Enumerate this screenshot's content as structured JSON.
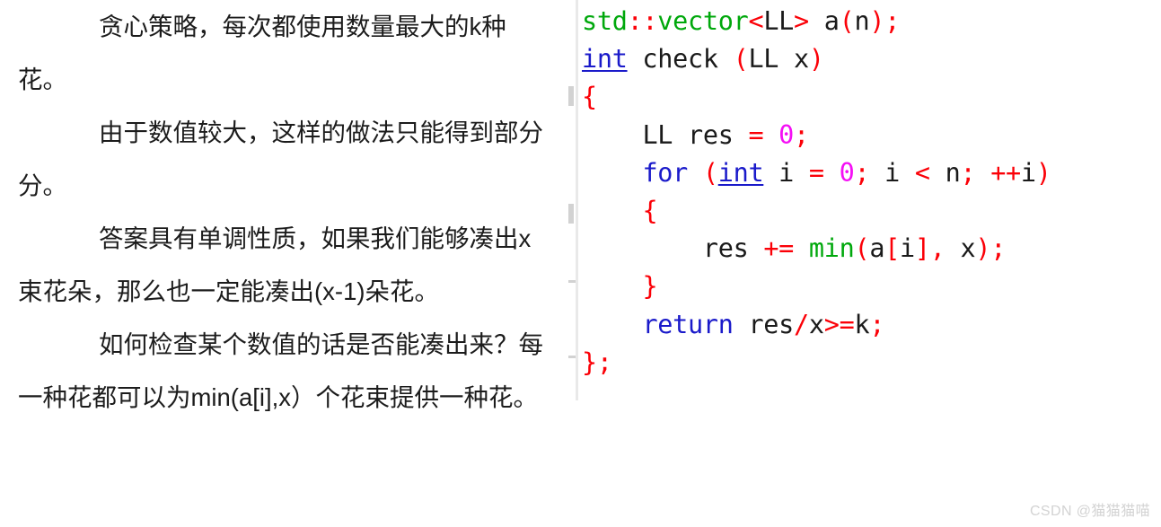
{
  "prose": {
    "paragraphs": [
      "贪心策略，每次都使用数量最大的k种花。",
      "由于数值较大，这样的做法只能得到部分分。",
      "答案具有单调性质，如果我们能够凑出x束花朵，那么也一定能凑出(x-1)朵花。",
      "如何检查某个数值的话是否能凑出来？每一种花都可以为min(a[i],x）个花束提供一种花。"
    ]
  },
  "code": {
    "language": "cpp",
    "lines": [
      {
        "indent": 0,
        "tokens": [
          {
            "t": "std",
            "c": "fn"
          },
          {
            "t": "::",
            "c": "pun"
          },
          {
            "t": "vector",
            "c": "fn"
          },
          {
            "t": "<",
            "c": "pun"
          },
          {
            "t": "LL",
            "c": "id"
          },
          {
            "t": ">",
            "c": "pun"
          },
          {
            "t": " a",
            "c": "id"
          },
          {
            "t": "(",
            "c": "pun"
          },
          {
            "t": "n",
            "c": "id"
          },
          {
            "t": ")",
            "c": "pun"
          },
          {
            "t": ";",
            "c": "pun"
          }
        ]
      },
      {
        "indent": 0,
        "tokens": [
          {
            "t": "int",
            "c": "kw"
          },
          {
            "t": " check ",
            "c": "id"
          },
          {
            "t": "(",
            "c": "pun"
          },
          {
            "t": "LL x",
            "c": "id"
          },
          {
            "t": ")",
            "c": "pun"
          }
        ]
      },
      {
        "indent": 0,
        "tokens": [
          {
            "t": "{",
            "c": "pun"
          }
        ]
      },
      {
        "indent": 4,
        "tokens": [
          {
            "t": "LL res ",
            "c": "id"
          },
          {
            "t": "=",
            "c": "pun"
          },
          {
            "t": " ",
            "c": "id"
          },
          {
            "t": "0",
            "c": "num"
          },
          {
            "t": ";",
            "c": "pun"
          }
        ]
      },
      {
        "indent": 4,
        "tokens": [
          {
            "t": "for",
            "c": "kw2"
          },
          {
            "t": " ",
            "c": "id"
          },
          {
            "t": "(",
            "c": "pun"
          },
          {
            "t": "int",
            "c": "kw"
          },
          {
            "t": " i ",
            "c": "id"
          },
          {
            "t": "=",
            "c": "pun"
          },
          {
            "t": " ",
            "c": "id"
          },
          {
            "t": "0",
            "c": "num"
          },
          {
            "t": ";",
            "c": "pun"
          },
          {
            "t": " i ",
            "c": "id"
          },
          {
            "t": "<",
            "c": "pun"
          },
          {
            "t": " n",
            "c": "id"
          },
          {
            "t": ";",
            "c": "pun"
          },
          {
            "t": " ",
            "c": "id"
          },
          {
            "t": "++",
            "c": "pun"
          },
          {
            "t": "i",
            "c": "id"
          },
          {
            "t": ")",
            "c": "pun"
          }
        ]
      },
      {
        "indent": 4,
        "tokens": [
          {
            "t": "{",
            "c": "pun"
          }
        ]
      },
      {
        "indent": 8,
        "tokens": [
          {
            "t": "res ",
            "c": "id"
          },
          {
            "t": "+=",
            "c": "pun"
          },
          {
            "t": " ",
            "c": "id"
          },
          {
            "t": "min",
            "c": "fn"
          },
          {
            "t": "(",
            "c": "pun"
          },
          {
            "t": "a",
            "c": "id"
          },
          {
            "t": "[",
            "c": "pun"
          },
          {
            "t": "i",
            "c": "id"
          },
          {
            "t": "]",
            "c": "pun"
          },
          {
            "t": ",",
            "c": "pun"
          },
          {
            "t": " x",
            "c": "id"
          },
          {
            "t": ")",
            "c": "pun"
          },
          {
            "t": ";",
            "c": "pun"
          }
        ]
      },
      {
        "indent": 4,
        "tokens": [
          {
            "t": "}",
            "c": "pun"
          }
        ]
      },
      {
        "indent": 4,
        "tokens": [
          {
            "t": "return",
            "c": "kw2"
          },
          {
            "t": " res",
            "c": "id"
          },
          {
            "t": "/",
            "c": "pun"
          },
          {
            "t": "x",
            "c": "id"
          },
          {
            "t": ">=",
            "c": "pun"
          },
          {
            "t": "k",
            "c": "id"
          },
          {
            "t": ";",
            "c": "pun"
          }
        ]
      },
      {
        "indent": 0,
        "tokens": [
          {
            "t": "}",
            "c": "pun"
          },
          {
            "t": ";",
            "c": "pun"
          }
        ]
      }
    ],
    "colors": {
      "keyword": "#1a1aca",
      "function": "#00a80c",
      "punctuation": "#fb0007",
      "number": "#f50ff5",
      "identifier": "#1a1a1a",
      "background": "#ffffff",
      "gutter": "#e9e9e9"
    }
  },
  "watermark": {
    "text": "CSDN @猫猫猫喵",
    "color": "#d3d3d3"
  }
}
